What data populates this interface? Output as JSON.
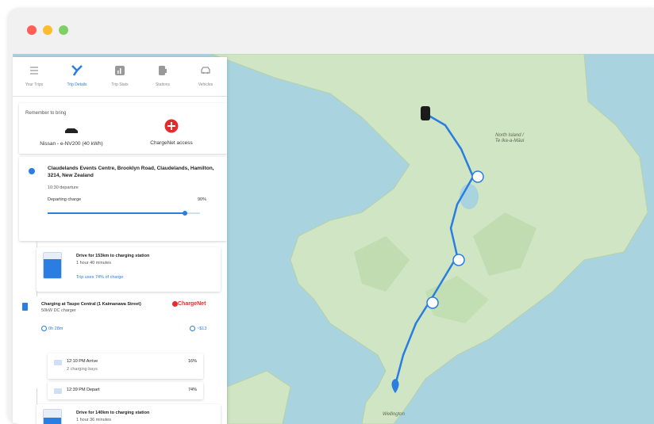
{
  "tabs": [
    {
      "label": "Your Trips",
      "icon": "list-icon",
      "active": false
    },
    {
      "label": "Trip Details",
      "icon": "route-icon",
      "active": true
    },
    {
      "label": "Trip Stats",
      "icon": "stats-icon",
      "active": false
    },
    {
      "label": "Stations",
      "icon": "station-icon",
      "active": false
    },
    {
      "label": "Vehicles",
      "icon": "car-icon",
      "active": false
    }
  ],
  "remember": {
    "title": "Remember to bring",
    "vehicle": "Nissan - e-NV200 (40 kWh)",
    "access": "ChargeNet access"
  },
  "origin": {
    "address": "Claudelands Events Centre, Brooklyn Road, Claudelands, Hamilton, 3214, New Zealand",
    "departure": "10:30 departure",
    "charge_label": "Departing charge",
    "charge_value": "90%",
    "charge_fraction": 0.9
  },
  "leg1": {
    "title": "Drive for 153km to charging station",
    "duration": "1 hour 40 minutes",
    "usage": "Trip uses 74% of charge",
    "battery_fraction": 0.74
  },
  "charging": {
    "title": "Charging at Taupo Central (1 Kaimanawa Street)",
    "charger": "50kW DC charger",
    "brand": "ChargeNet",
    "time": "0h 28m",
    "cost": "~$13",
    "arrive": {
      "time": "12:10 PM Arrive",
      "bays": "2 charging bays",
      "pct": "16%"
    },
    "depart": {
      "time": "12:39 PM Depart",
      "pct": "74%"
    }
  },
  "leg2": {
    "title": "Drive for 140km to charging station",
    "duration": "1 hour 36 minutes",
    "battery_fraction": 0.7
  },
  "map": {
    "labels": [
      "North Island / Te Ika-a-Māui",
      "Wellington"
    ]
  },
  "colors": {
    "accent": "#2a7de1",
    "chargenet": "#e52b2b",
    "sea": "#a9d3df",
    "land": "#cfe5c4"
  }
}
